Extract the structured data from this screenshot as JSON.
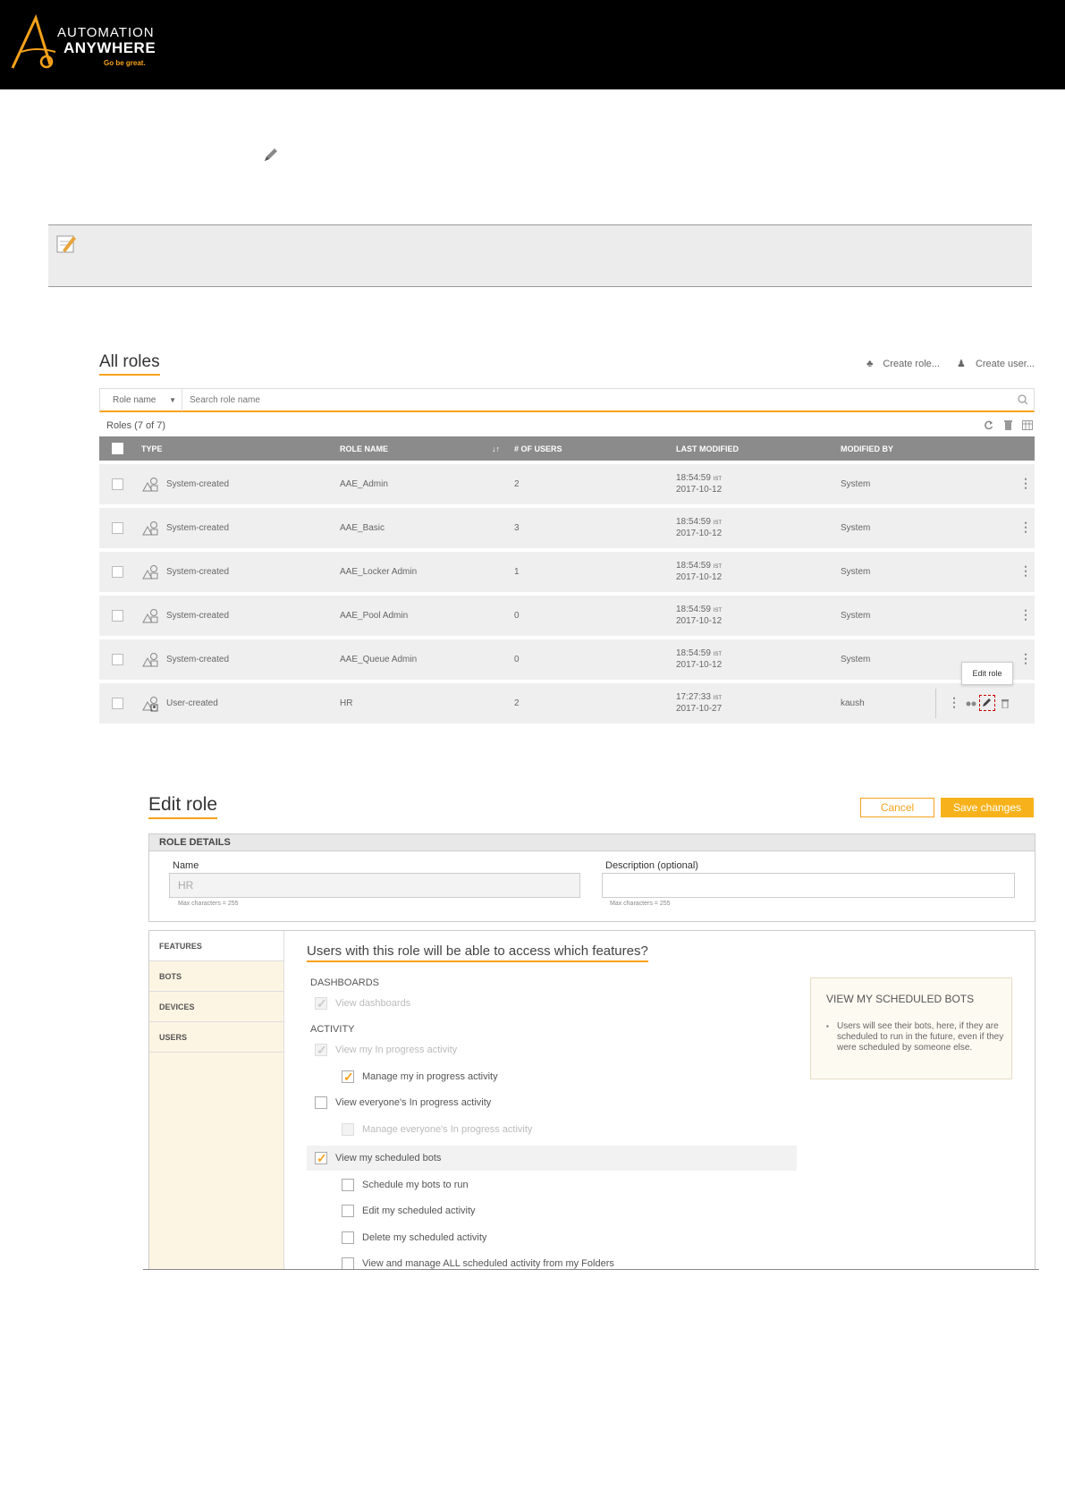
{
  "header": {
    "brand_line1": "AUTOMATION",
    "brand_line2": "ANYWHERE",
    "tagline": "Go be great."
  },
  "all_roles": {
    "title": "All roles",
    "create_role": "Create role...",
    "create_user": "Create user...",
    "search_filter": "Role name",
    "search_placeholder": "Search role name",
    "count": "Roles (7 of 7)",
    "columns": [
      "TYPE",
      "ROLE NAME",
      "# OF USERS",
      "LAST MODIFIED",
      "MODIFIED BY"
    ],
    "rows": [
      {
        "type": "System-created",
        "name": "AAE_Admin",
        "users": "2",
        "time": "18:54:59",
        "tz": "IST",
        "date": "2017-10-12",
        "by": "System"
      },
      {
        "type": "System-created",
        "name": "AAE_Basic",
        "users": "3",
        "time": "18:54:59",
        "tz": "IST",
        "date": "2017-10-12",
        "by": "System"
      },
      {
        "type": "System-created",
        "name": "AAE_Locker Admin",
        "users": "1",
        "time": "18:54:59",
        "tz": "IST",
        "date": "2017-10-12",
        "by": "System"
      },
      {
        "type": "System-created",
        "name": "AAE_Pool Admin",
        "users": "0",
        "time": "18:54:59",
        "tz": "IST",
        "date": "2017-10-12",
        "by": "System"
      },
      {
        "type": "System-created",
        "name": "AAE_Queue Admin",
        "users": "0",
        "time": "18:54:59",
        "tz": "IST",
        "date": "2017-10-12",
        "by": "System"
      },
      {
        "type": "User-created",
        "name": "HR",
        "users": "2",
        "time": "17:27:33",
        "tz": "IST",
        "date": "2017-10-27",
        "by": "kaush"
      }
    ],
    "tooltip": "Edit role"
  },
  "edit_role": {
    "title": "Edit role",
    "cancel": "Cancel",
    "save": "Save changes",
    "details_header": "ROLE DETAILS",
    "name_label": "Name",
    "name_value": "HR",
    "name_hint": "Max characters = 255",
    "desc_label": "Description (optional)",
    "desc_hint": "Max characters = 255",
    "tabs": [
      "FEATURES",
      "BOTS",
      "DEVICES",
      "USERS"
    ],
    "question": "Users with this role will be able to access which features?",
    "sec_dashboards": "DASHBOARDS",
    "sec_activity": "ACTIVITY",
    "options": [
      "View dashboards",
      "View my In progress activity",
      "Manage my in progress activity",
      "View everyone's In progress activity",
      "Manage everyone's In progress activity",
      "View my scheduled bots",
      "Schedule my bots to run",
      "Edit my scheduled activity",
      "Delete my scheduled activity",
      "View and manage ALL scheduled activity from my Folders"
    ],
    "info_title": "VIEW MY SCHEDULED BOTS",
    "info_body": "Users will see their bots, here, if they are scheduled to run in the future, even if they were scheduled by someone else."
  },
  "colors": {
    "accent": "#f7a21b",
    "header_bg": "#000000",
    "table_head": "#8b8b8b"
  }
}
